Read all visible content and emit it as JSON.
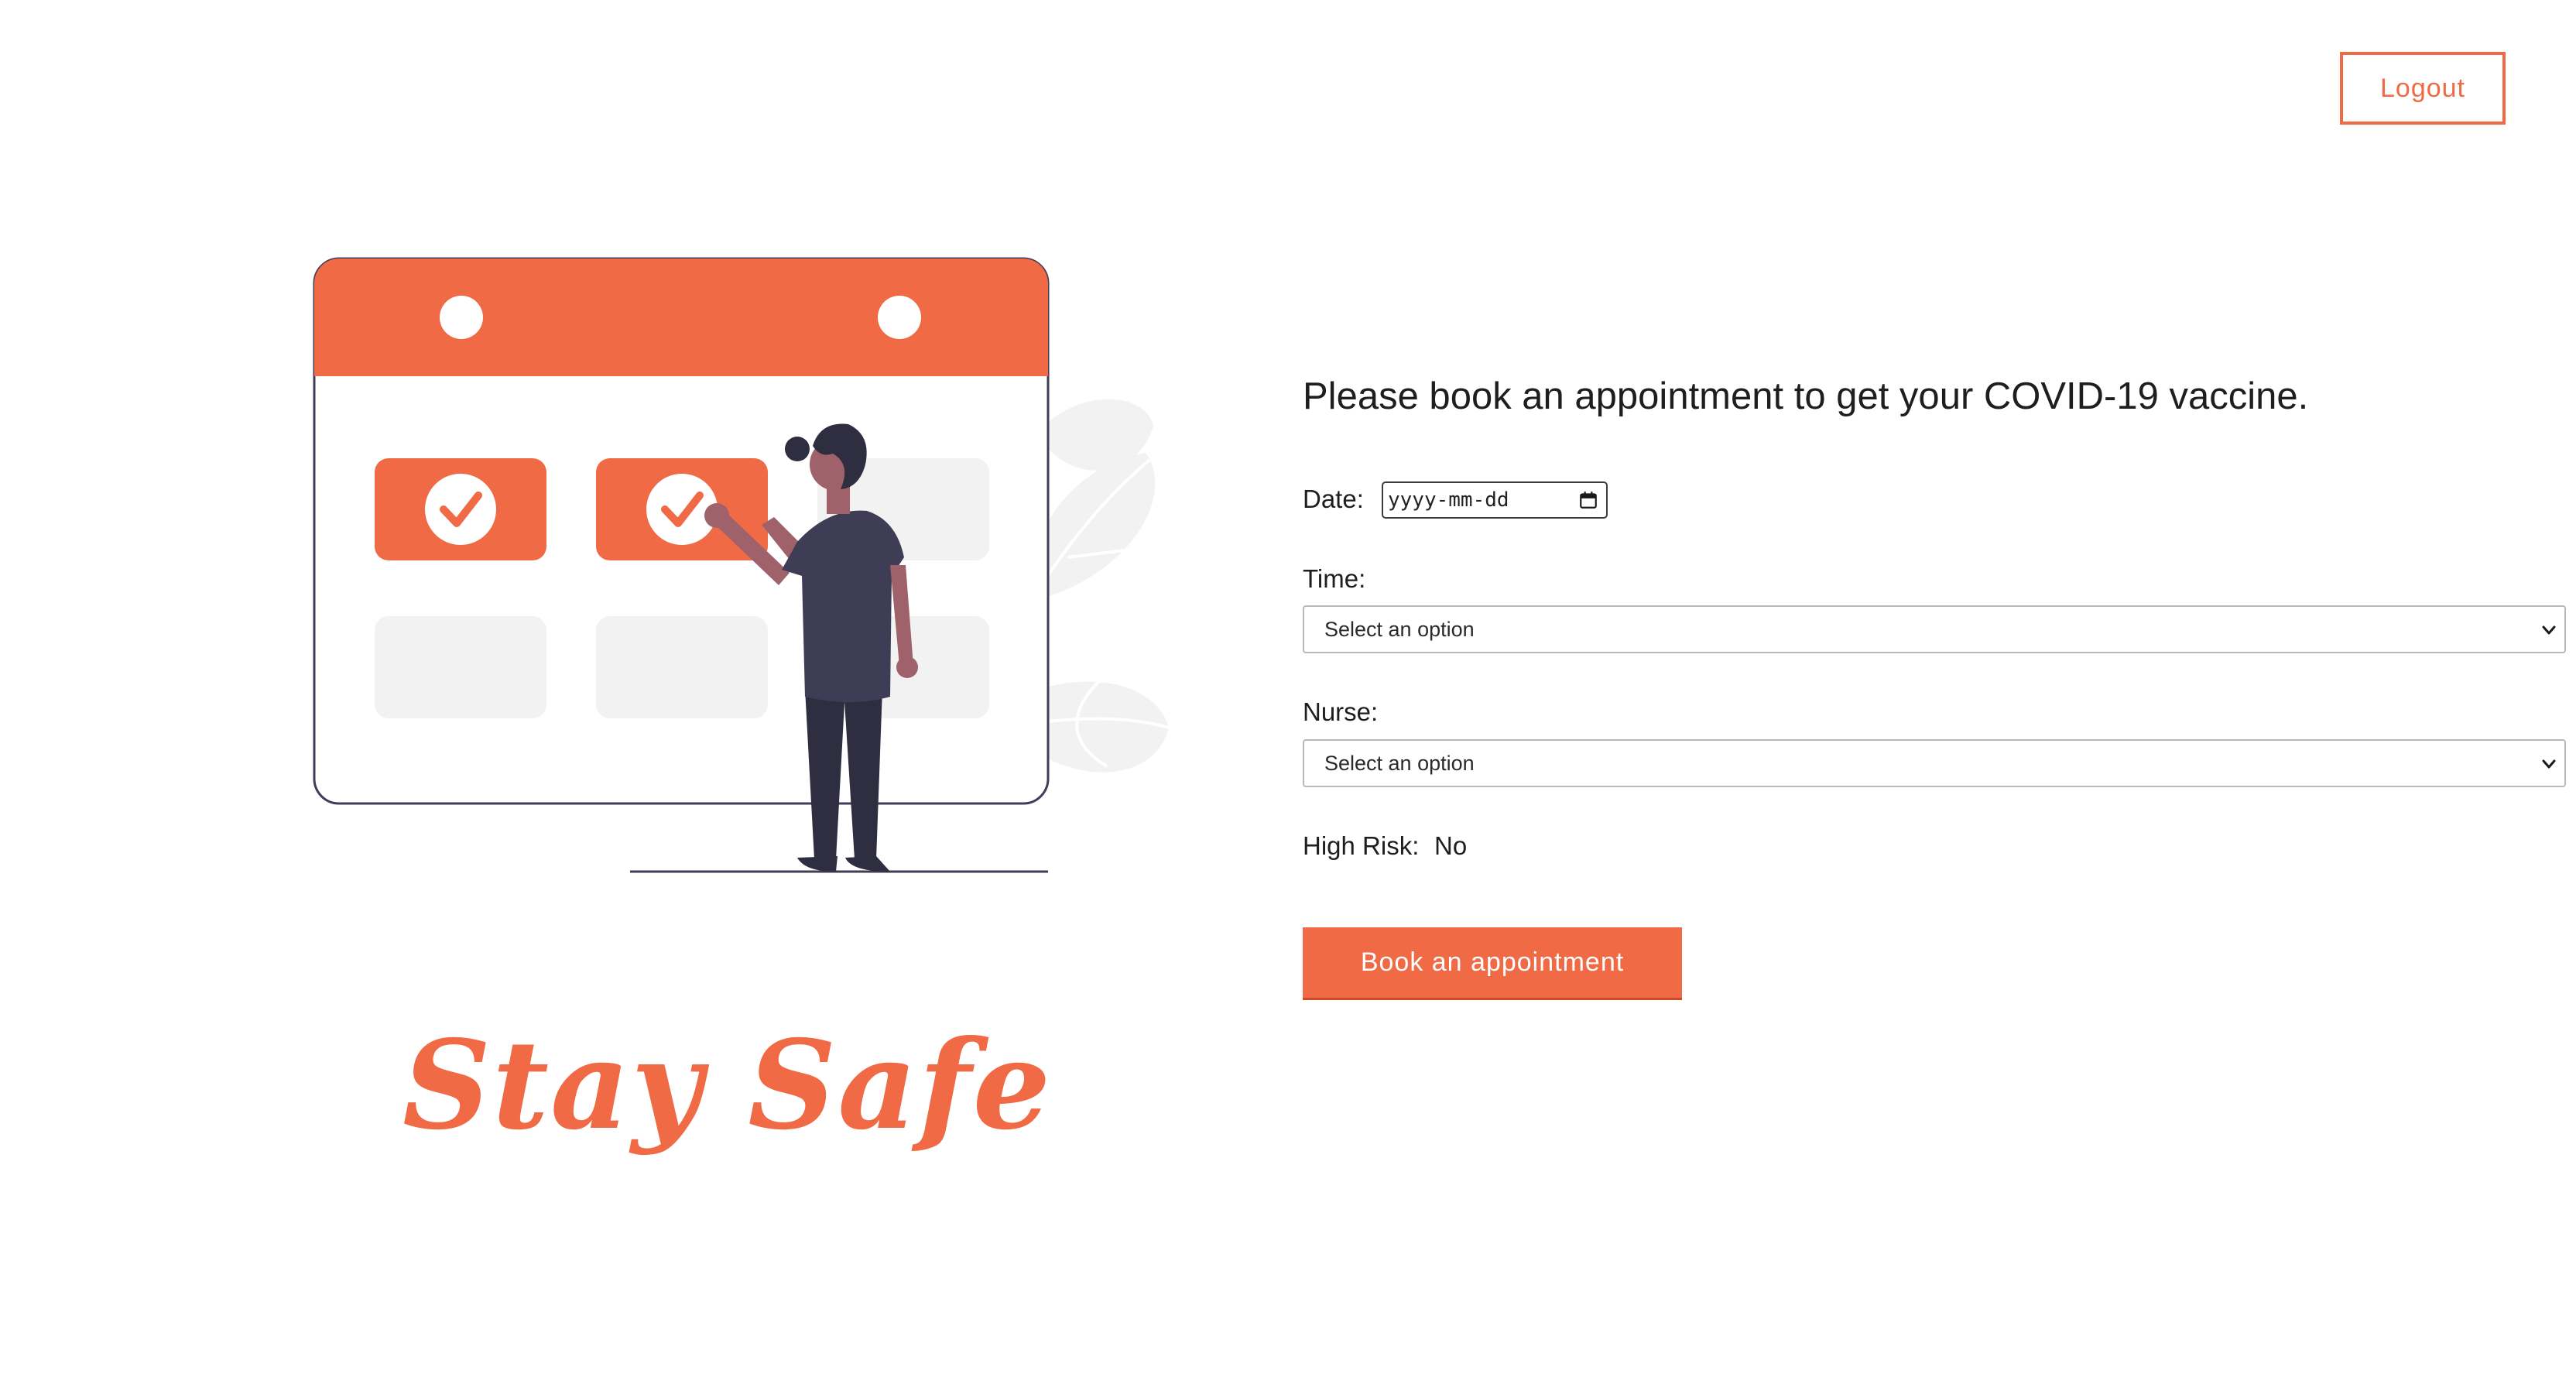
{
  "header": {
    "logout_label": "Logout"
  },
  "illustration": {
    "tagline": "Stay Safe"
  },
  "form": {
    "heading": "Please book an appointment to get your COVID-19 vaccine.",
    "date_label": "Date:",
    "date_placeholder": "yyyy-mm-dd",
    "time_label": "Time:",
    "time_selected": "Select an option",
    "nurse_label": "Nurse:",
    "nurse_selected": "Select an option",
    "high_risk_label": "High Risk:",
    "high_risk_value": "No",
    "submit_label": "Book an appointment"
  },
  "icons": {
    "date_picker": "calendar-icon",
    "select_arrow": "chevron-down-icon",
    "illustration_check": "check-icon"
  },
  "colors": {
    "accent": "#ef6a45",
    "text": "#1e1e1e",
    "placeholder_tile": "#f2f2f2",
    "figure_dark": "#3f3d56"
  }
}
